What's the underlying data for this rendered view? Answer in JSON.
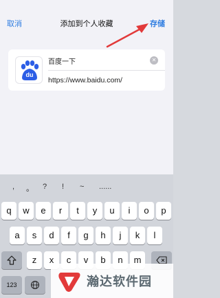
{
  "nav": {
    "cancel": "取消",
    "title": "添加到个人收藏",
    "save": "存储"
  },
  "bookmark": {
    "title": "百度一下",
    "url": "https://www.baidu.com/",
    "logo_icon": "baidu-paw-icon",
    "logo_text": "du"
  },
  "keyboard": {
    "candidates": [
      ",",
      "。",
      "?",
      "!",
      "~",
      "......"
    ],
    "row1": [
      "q",
      "w",
      "e",
      "r",
      "t",
      "y",
      "u",
      "i",
      "o",
      "p"
    ],
    "row2": [
      "a",
      "s",
      "d",
      "f",
      "g",
      "h",
      "j",
      "k",
      "l"
    ],
    "row3": [
      "z",
      "x",
      "c",
      "v",
      "b",
      "n",
      "m"
    ],
    "numbers_key": "123",
    "shift_icon": "shift-icon",
    "delete_icon": "delete-icon",
    "globe_icon": "globe-icon"
  },
  "watermark": {
    "text": "瀚达软件园"
  },
  "colors": {
    "accent": "#2f7de1",
    "arrow": "#e23a3a",
    "logo_blue": "#2c5ee6"
  }
}
